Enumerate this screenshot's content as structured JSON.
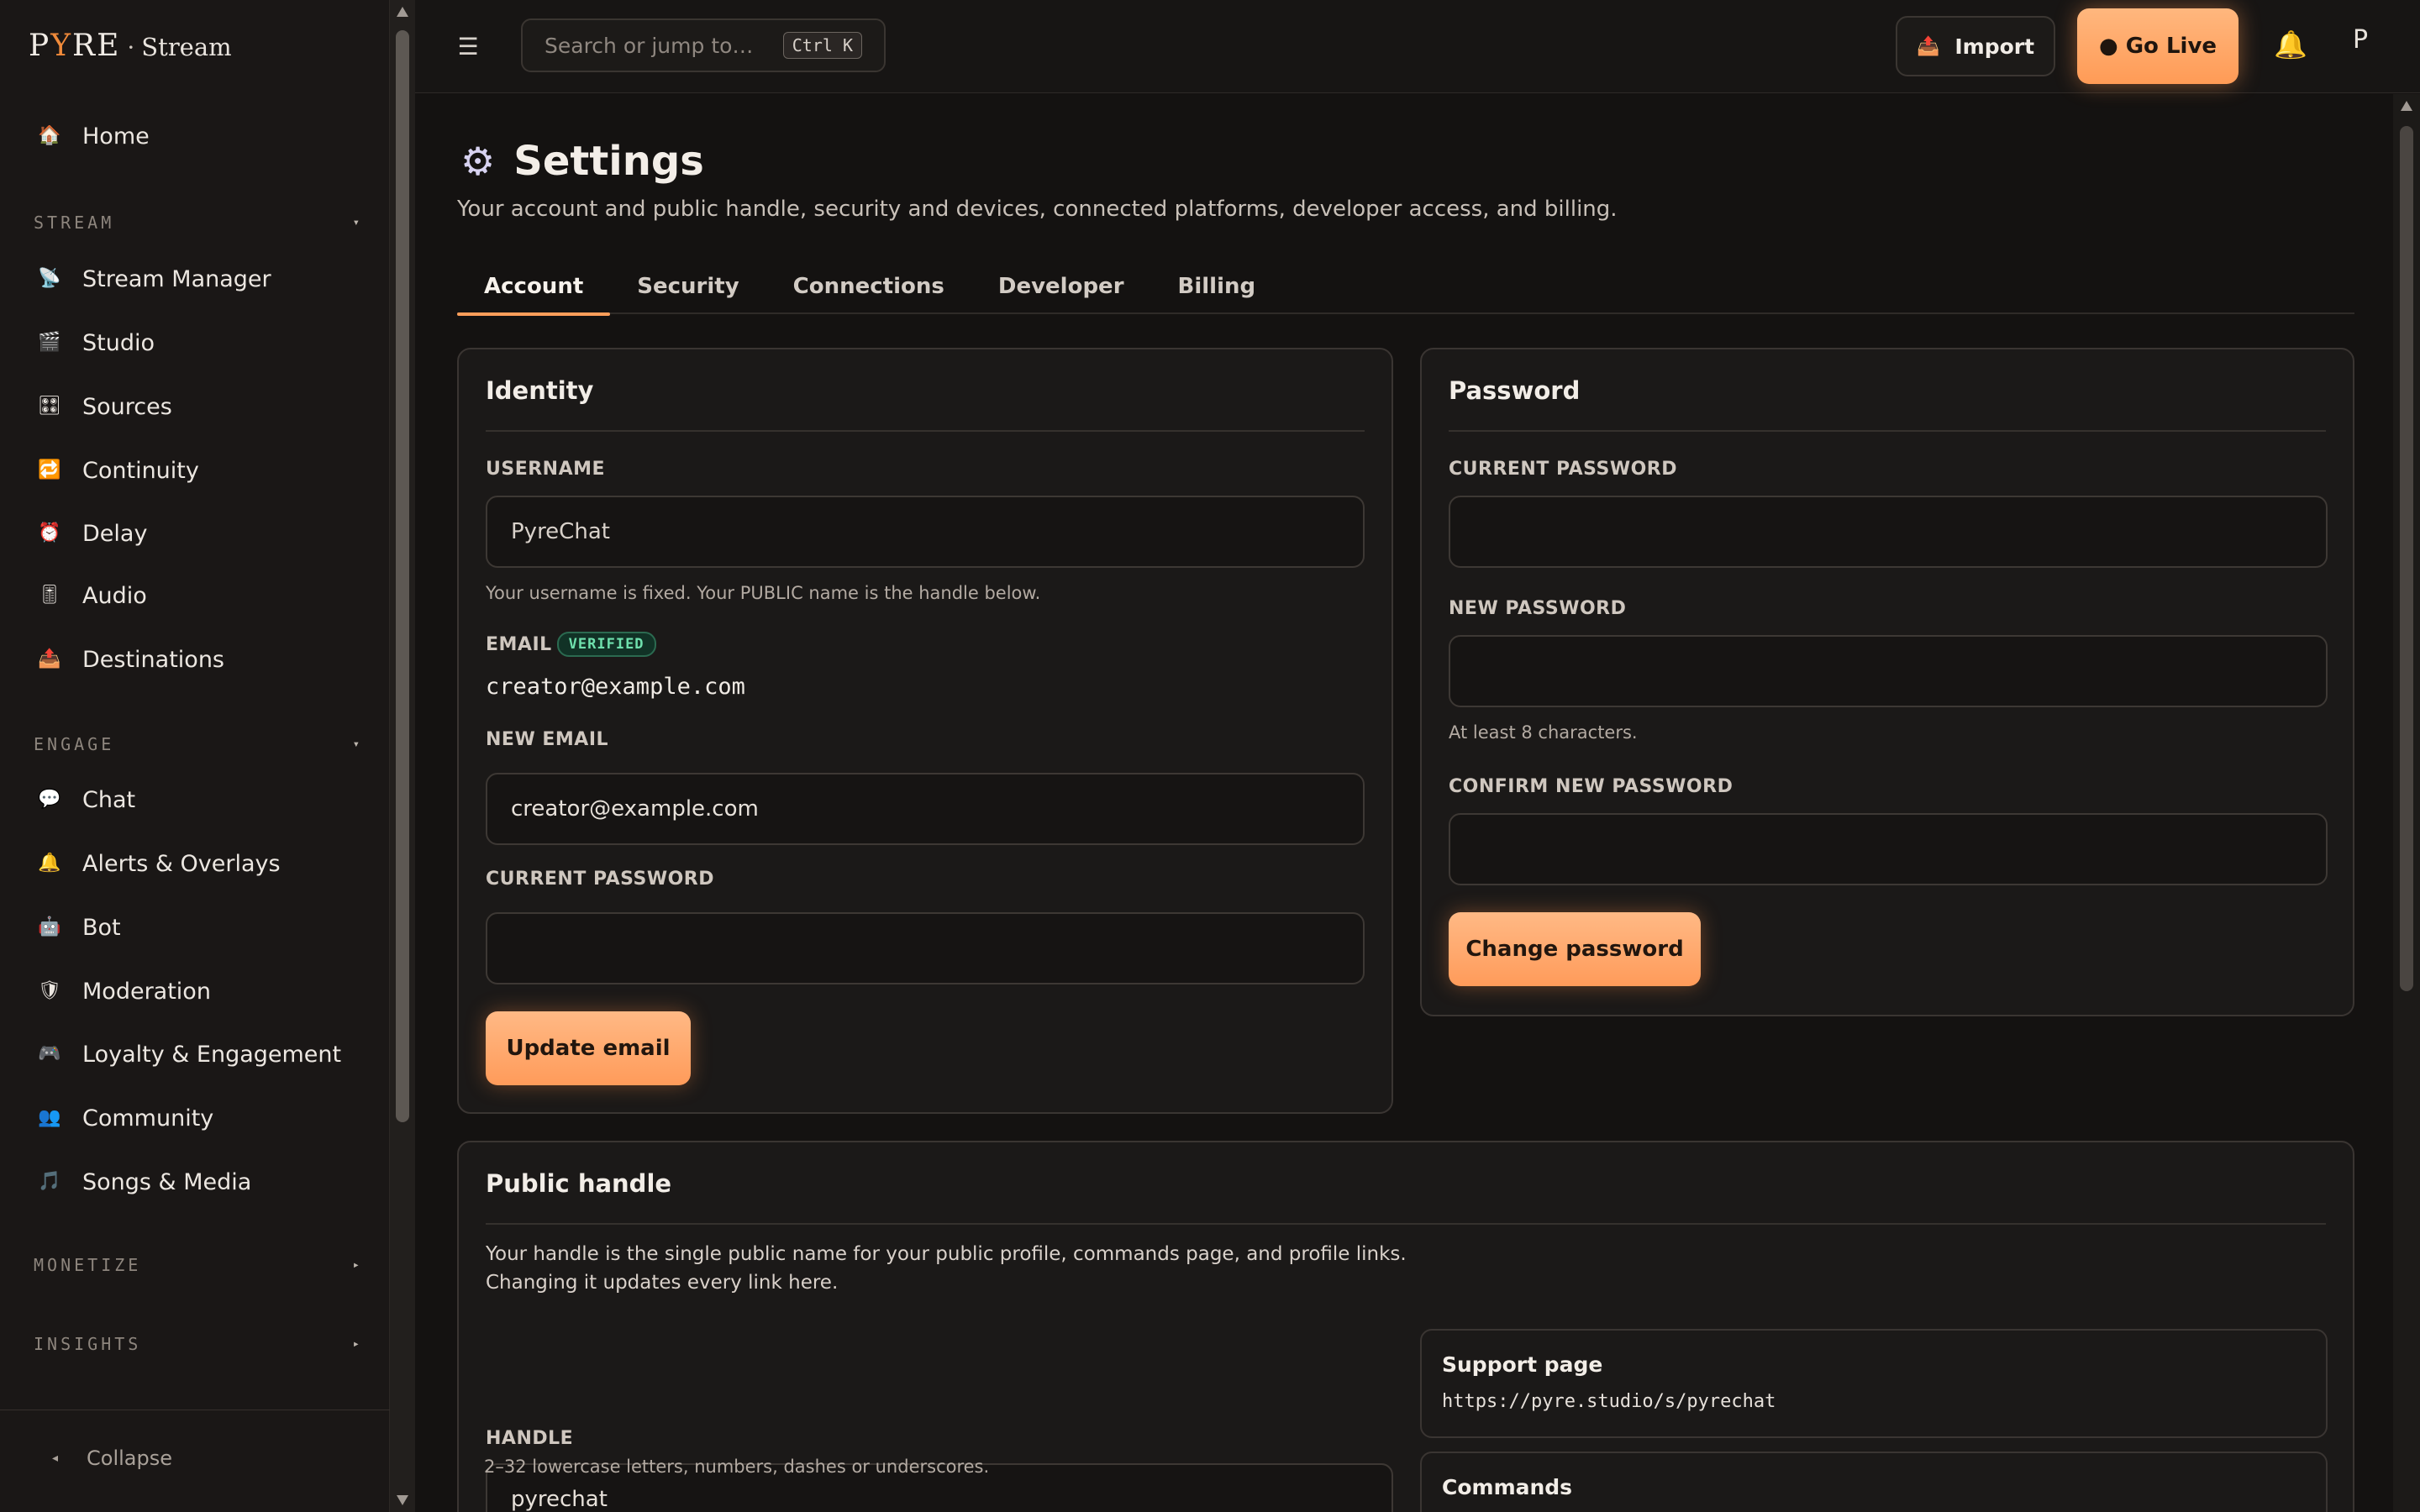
{
  "brand": {
    "logo_prefix": "P",
    "logo_flame": "Y",
    "logo_suffix": "RE",
    "separator": "·",
    "product": "Stream"
  },
  "sidebar": {
    "home": {
      "label": "Home",
      "icon": "house-icon"
    },
    "sections": [
      {
        "key": "stream",
        "title": "STREAM",
        "caret": "▾"
      },
      {
        "key": "engage",
        "title": "ENGAGE",
        "caret": "▾"
      },
      {
        "key": "monetize",
        "title": "MONETIZE",
        "caret": "▸"
      },
      {
        "key": "insights",
        "title": "INSIGHTS",
        "caret": "▸"
      }
    ],
    "stream_items": [
      {
        "label": "Stream Manager",
        "icon": "satellite-icon",
        "glyph": "📡"
      },
      {
        "label": "Studio",
        "icon": "clapper-icon",
        "glyph": "🎬"
      },
      {
        "label": "Sources",
        "icon": "grid-icon",
        "glyph": "🎛"
      },
      {
        "label": "Continuity",
        "icon": "repeat-icon",
        "glyph": "🔁"
      },
      {
        "label": "Delay",
        "icon": "alarm-clock-icon",
        "glyph": "⏰"
      },
      {
        "label": "Audio",
        "icon": "level-meter-icon",
        "glyph": "🎚"
      },
      {
        "label": "Destinations",
        "icon": "outbox-icon",
        "glyph": "📤"
      }
    ],
    "engage_items": [
      {
        "label": "Chat",
        "icon": "speech-bubble-icon",
        "glyph": "💬"
      },
      {
        "label": "Alerts & Overlays",
        "icon": "bell-icon",
        "glyph": "🔔"
      },
      {
        "label": "Bot",
        "icon": "robot-icon",
        "glyph": "🤖"
      },
      {
        "label": "Moderation",
        "icon": "shield-icon",
        "glyph": "🛡"
      },
      {
        "label": "Loyalty & Engagement",
        "icon": "gamepad-icon",
        "glyph": "🎮"
      },
      {
        "label": "Community",
        "icon": "people-icon",
        "glyph": "👥"
      },
      {
        "label": "Songs & Media",
        "icon": "music-note-icon",
        "glyph": "🎵"
      }
    ],
    "collapse_label": "Collapse"
  },
  "topbar": {
    "search_placeholder": "Search or jump to…",
    "shortcut": "Ctrl K",
    "import_label": "Import",
    "go_live_label": "● Go Live",
    "avatar_initial": "P"
  },
  "page": {
    "title": "Settings",
    "subtitle": "Your account and public handle, security and devices, connected platforms, developer access, and billing.",
    "tabs": [
      "Account",
      "Security",
      "Connections",
      "Developer",
      "Billing"
    ],
    "active_tab": "Account"
  },
  "identity": {
    "title": "Identity",
    "username_label": "USERNAME",
    "username_value": "PyreChat",
    "username_hint": "Your username is fixed. Your PUBLIC name is the handle below.",
    "email_label": "EMAIL",
    "email_badge": "VERIFIED",
    "email_value": "creator@example.com",
    "new_email_label": "NEW EMAIL",
    "new_email_value": "creator@example.com",
    "current_password_label": "CURRENT PASSWORD",
    "current_password_value": "",
    "update_button": "Update email"
  },
  "password": {
    "title": "Password",
    "current_label": "CURRENT PASSWORD",
    "new_label": "NEW PASSWORD",
    "new_hint": "At least 8 characters.",
    "confirm_label": "CONFIRM NEW PASSWORD",
    "change_button": "Change password"
  },
  "public_handle": {
    "title": "Public handle",
    "description_line1": "Your handle is the single public name for your public profile, commands page, and profile links.",
    "description_line2": "Changing it updates every link here.",
    "handle_label": "HANDLE",
    "handle_value": "pyrechat",
    "handle_hint": "2–32 lowercase letters, numbers, dashes or underscores.",
    "links": [
      {
        "title": "Support page",
        "url": "https://pyre.studio/s/pyrechat"
      },
      {
        "title": "Commands",
        "url": ""
      }
    ]
  },
  "colors": {
    "accent": "#ff9e5a",
    "verified": "#6fe0ad",
    "background": "#141211"
  }
}
